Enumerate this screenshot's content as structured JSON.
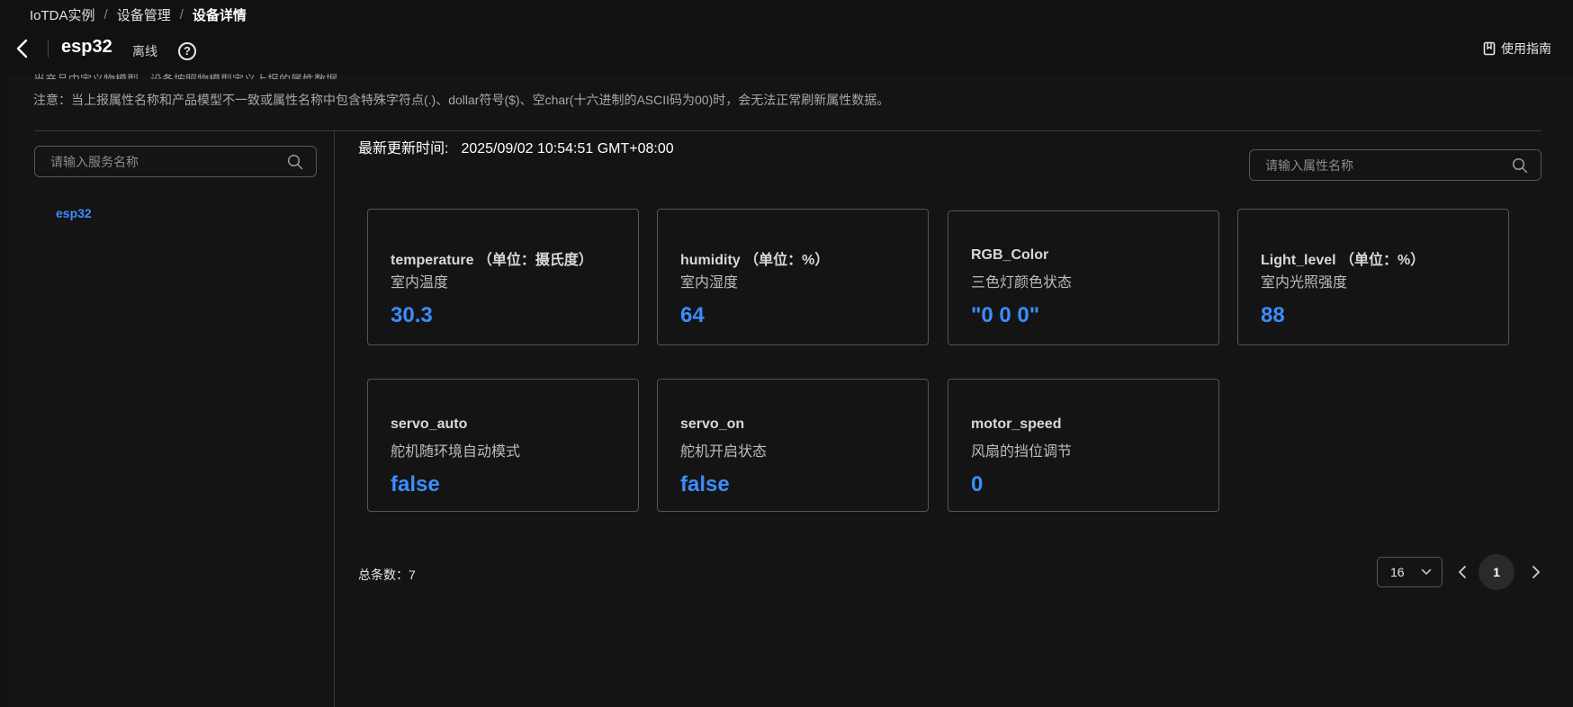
{
  "breadcrumb": {
    "items": [
      "IoTDA实例",
      "设备管理",
      "设备详情"
    ],
    "separator": "/"
  },
  "device": {
    "name": "esp32",
    "status": "离线"
  },
  "header": {
    "guide_label": "使用指南"
  },
  "notices": {
    "cut_line": "当产品中定义物模型，设备按照物模型定义上报的属性数据",
    "line": "注意：当上报属性名称和产品模型不一致或属性名称中包含特殊字符点(.)、dollar符号($)、空char(十六进制的ASCII码为00)时，会无法正常刷新属性数据。"
  },
  "sidebar": {
    "search_placeholder": "请输入服务名称",
    "services": [
      "esp32"
    ]
  },
  "main": {
    "update_label": "最新更新时间:",
    "update_time": "2025/09/02 10:54:51 GMT+08:00",
    "property_search_placeholder": "请输入属性名称",
    "properties": [
      {
        "name": "temperature （单位：摄氏度）",
        "desc": "室内温度",
        "value": "30.3"
      },
      {
        "name": "humidity （单位：%）",
        "desc": "室内湿度",
        "value": "64"
      },
      {
        "name": "RGB_Color",
        "desc": "三色灯颜色状态",
        "value": "\"0 0 0\""
      },
      {
        "name": "Light_level （单位：%）",
        "desc": "室内光照强度",
        "value": "88"
      },
      {
        "name": "servo_auto",
        "desc": "舵机随环境自动模式",
        "value": "false"
      },
      {
        "name": "servo_on",
        "desc": "舵机开启状态",
        "value": "false"
      },
      {
        "name": "motor_speed",
        "desc": "风扇的挡位调节",
        "value": "0"
      }
    ]
  },
  "pagination": {
    "total_label": "总条数：7",
    "page_size": "16",
    "current_page": "1"
  },
  "colors": {
    "background": "#111111",
    "accent": "#3b8cff",
    "border": "#555555"
  }
}
